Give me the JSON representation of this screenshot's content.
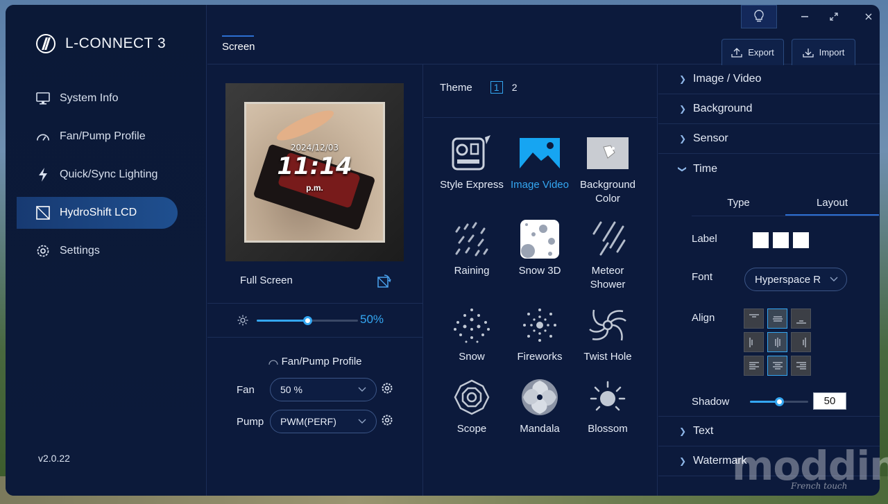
{
  "app": {
    "title": "L-CONNECT 3",
    "version": "v2.0.22"
  },
  "sidebar": {
    "items": [
      {
        "label": "System Info",
        "icon": "monitor-icon",
        "active": false
      },
      {
        "label": "Fan/Pump Profile",
        "icon": "gauge-icon",
        "active": false
      },
      {
        "label": "Quick/Sync Lighting",
        "icon": "lightning-icon",
        "active": false
      },
      {
        "label": "HydroShift LCD",
        "icon": "lcd-icon",
        "active": true
      },
      {
        "label": "Settings",
        "icon": "gear-icon",
        "active": false
      }
    ]
  },
  "header": {
    "tab": "Screen",
    "export_label": "Export",
    "import_label": "Import"
  },
  "preview": {
    "date": "2024/12/03",
    "time": "11:14",
    "ampm": "p.m.",
    "mode_label": "Full Screen",
    "brightness_value": "50%",
    "brightness_fraction": 0.5,
    "fan_pump_title": "Fan/Pump Profile",
    "fan_label": "Fan",
    "fan_value": "50 %",
    "pump_label": "Pump",
    "pump_value": "PWM(PERF)"
  },
  "theme": {
    "label": "Theme",
    "pages": [
      "1",
      "2"
    ],
    "active_page": "1",
    "items": [
      {
        "label": "Style Express",
        "icon": "style-express-icon"
      },
      {
        "label": "Image Video",
        "icon": "image-video-icon",
        "selected": true
      },
      {
        "label": "Background Color",
        "icon": "paint-bucket-icon"
      },
      {
        "label": "Raining",
        "icon": "rain-icon"
      },
      {
        "label": "Snow 3D",
        "icon": "snow-3d-icon"
      },
      {
        "label": "Meteor Shower",
        "icon": "meteor-icon"
      },
      {
        "label": "Snow",
        "icon": "snow-icon"
      },
      {
        "label": "Fireworks",
        "icon": "fireworks-icon"
      },
      {
        "label": "Twist Hole",
        "icon": "twist-hole-icon"
      },
      {
        "label": "Scope",
        "icon": "scope-icon"
      },
      {
        "label": "Mandala",
        "icon": "mandala-icon"
      },
      {
        "label": "Blossom",
        "icon": "blossom-icon"
      }
    ]
  },
  "props": {
    "sections": {
      "image_video": "Image / Video",
      "background": "Background",
      "sensor": "Sensor",
      "time": "Time",
      "text": "Text",
      "watermark": "Watermark"
    },
    "time_tabs": {
      "type": "Type",
      "layout": "Layout"
    },
    "label_label": "Label",
    "font_label": "Font",
    "font_value": "Hyperspace R",
    "align_label": "Align",
    "shadow_label": "Shadow",
    "shadow_value": "50",
    "shadow_fraction": 0.5
  },
  "overlay": {
    "watermark_text": "modding.fr",
    "watermark_sub": "French touch"
  },
  "colors": {
    "accent": "#34a7f2",
    "window_bg": "#0c1a3c",
    "active_nav": "#1f4f8f"
  }
}
